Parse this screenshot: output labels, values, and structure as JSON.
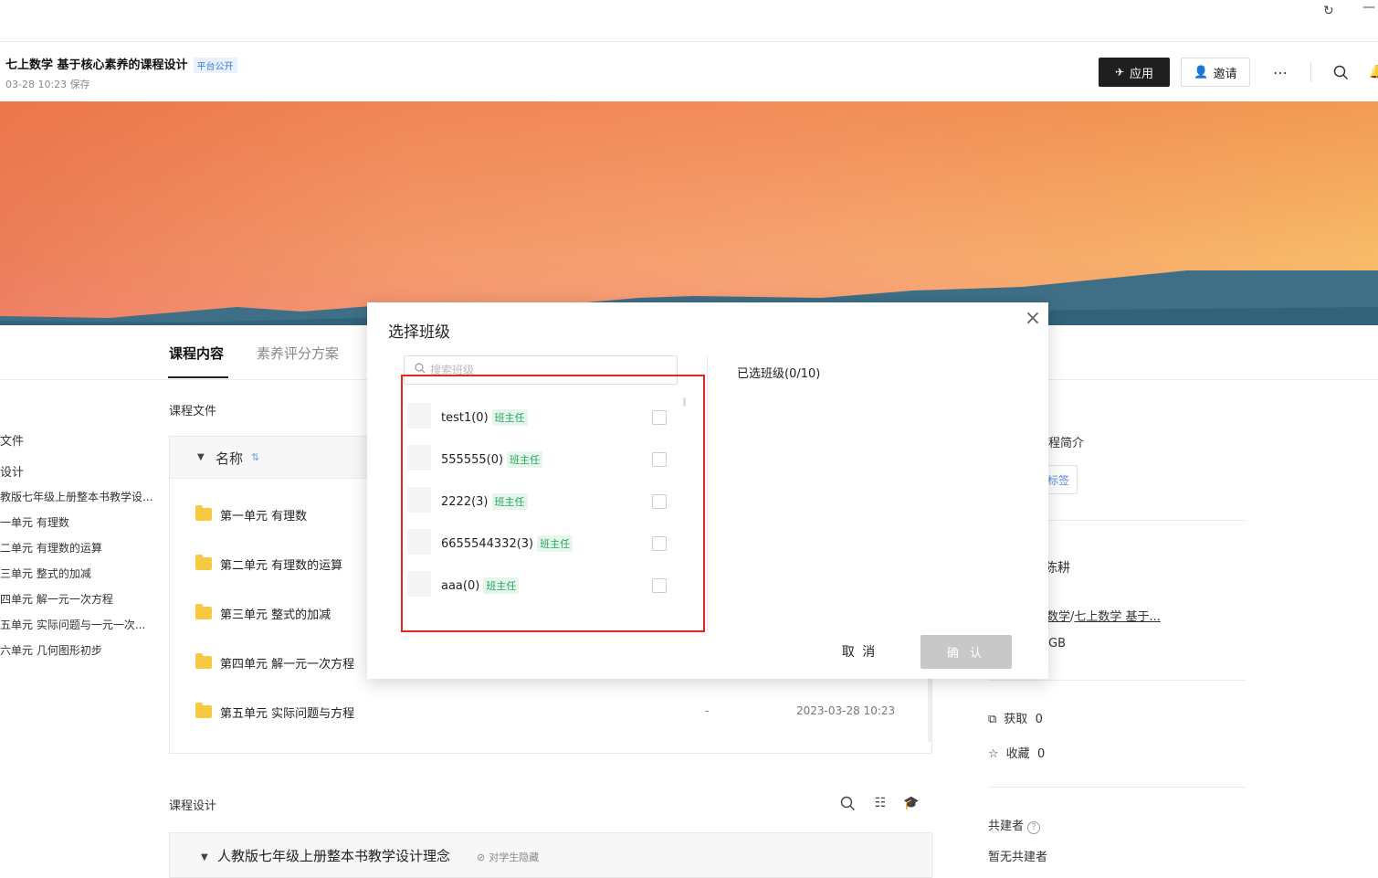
{
  "header": {
    "title": "七上数学 基于核心素养的课程设计",
    "visibility_badge": "平台公开",
    "saved_time": "03-28 10:23 保存",
    "apply_label": "应用",
    "invite_label": "邀请"
  },
  "tabs": [
    {
      "label": "课程内容",
      "active": true
    },
    {
      "label": "素养评分方案",
      "active": false
    }
  ],
  "left_tree": {
    "items": [
      "文件",
      "设计",
      "教版七年级上册整本书教学设...",
      "一单元 有理数",
      "二单元 有理数的运算",
      "三单元 整式的加减",
      "四单元 解一元一次方程",
      "五单元 实际问题与一元一次...",
      "六单元 几何图形初步"
    ]
  },
  "course_files": {
    "section_label": "课程文件",
    "column_name": "名称",
    "rows": [
      {
        "name": "第一单元 有理数",
        "size": "",
        "date": ""
      },
      {
        "name": "第二单元 有理数的运算",
        "size": "",
        "date": ""
      },
      {
        "name": "第三单元 整式的加减",
        "size": "",
        "date": ""
      },
      {
        "name": "第四单元 解一元一次方程",
        "size": "",
        "date": ""
      },
      {
        "name": "第五单元 实际问题与方程",
        "size": "-",
        "date": "2023-03-28 10:23"
      }
    ]
  },
  "course_design": {
    "section_label": "课程设计",
    "item_title": "人教版七年级上册整本书教学设计理念",
    "hidden_label": "对学生隐藏"
  },
  "right_sidebar": {
    "intro_label": "程简介",
    "tag_button": "标签",
    "author": "陈耕",
    "path_part1": "数学",
    "path_sep": "/",
    "path_part2": "七上数学 基于...",
    "storage": "GB",
    "acquire_label": "获取",
    "acquire_count": "0",
    "favorite_label": "收藏",
    "favorite_count": "0",
    "cobuilder_label": "共建者",
    "cobuilder_empty": "暂无共建者"
  },
  "modal": {
    "title": "选择班级",
    "search_placeholder": "搜索班级",
    "selected_label": "已选班级(0/10)",
    "classes": [
      {
        "name": "test1(0)",
        "role": "班主任",
        "checked": false
      },
      {
        "name": "555555(0)",
        "role": "班主任",
        "checked": false
      },
      {
        "name": "2222(3)",
        "role": "班主任",
        "checked": false
      },
      {
        "name": "6655544332(3)",
        "role": "班主任",
        "checked": false
      },
      {
        "name": "aaa(0)",
        "role": "班主任",
        "checked": false
      }
    ],
    "cancel_label": "取 消",
    "confirm_label": "确 认"
  },
  "colors": {
    "highlight_box": "#e5261f",
    "role_tag": "#23a85a",
    "apply_button_bg": "#1f1f1f"
  }
}
